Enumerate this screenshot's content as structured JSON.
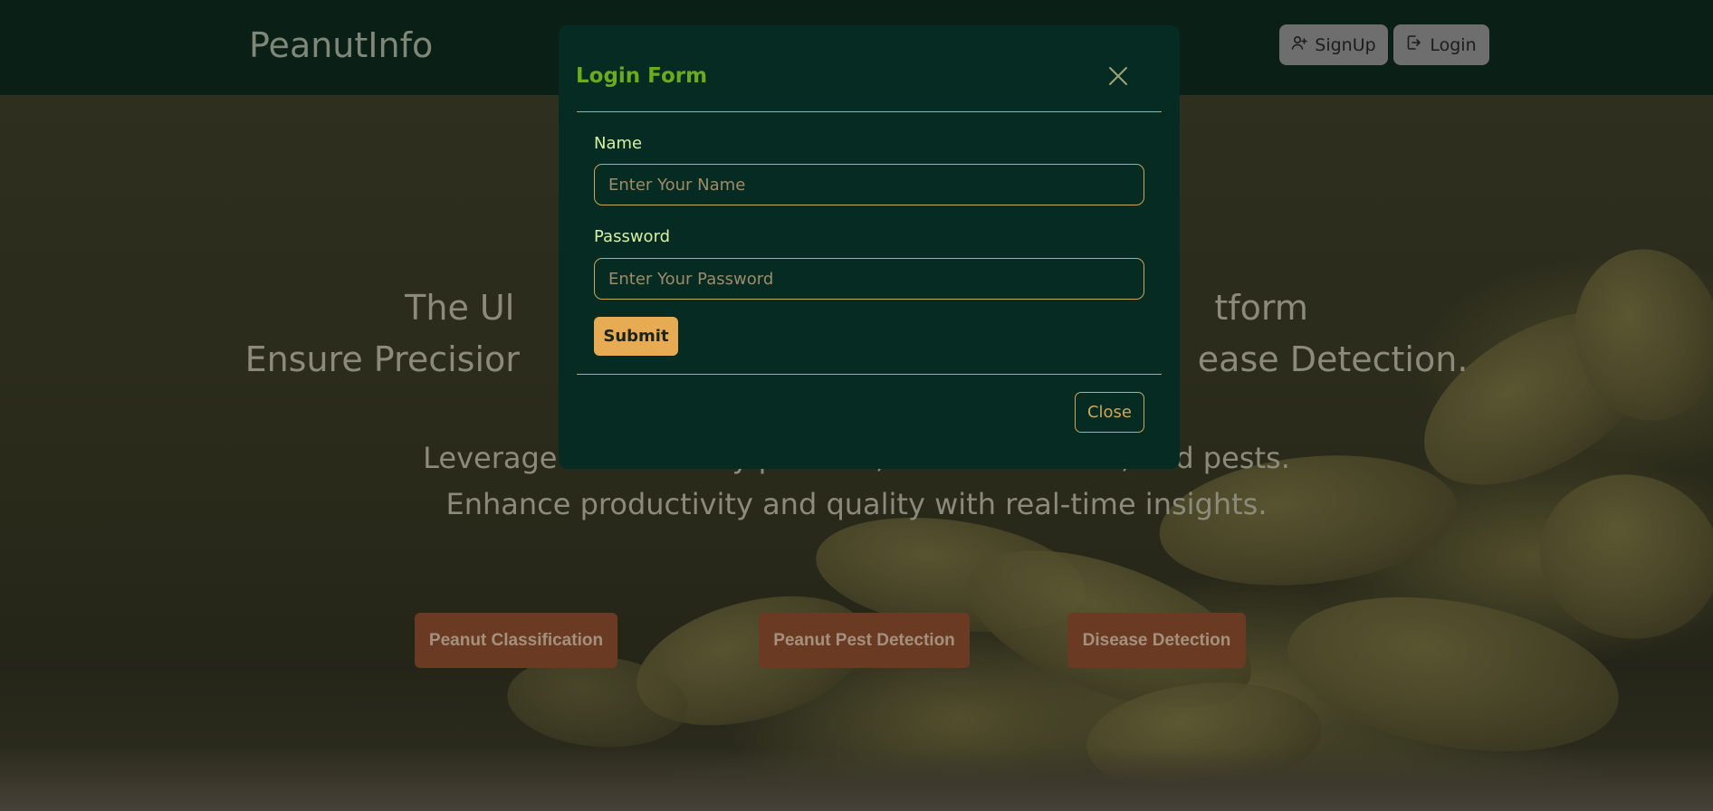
{
  "navbar": {
    "brand": "PeanutInfo",
    "signup_label": "SignUp",
    "login_label": "Login"
  },
  "hero": {
    "line1": "The Ul                                                                tform",
    "line2": "Ensure Precisior                                                              ease Detection.",
    "line3": "Leverage AI to classify peanuts, detect diseases, and pests.",
    "line4": "Enhance productivity and quality with real-time insights."
  },
  "features": [
    {
      "label": "Peanut Classification"
    },
    {
      "label": "Peanut Pest Detection"
    },
    {
      "label": "Disease Detection"
    }
  ],
  "modal": {
    "title": "Login Form",
    "name_label": "Name",
    "name_placeholder": "Enter Your Name",
    "password_label": "Password",
    "password_placeholder": "Enter Your Password",
    "submit_label": "Submit",
    "close_label": "Close"
  },
  "colors": {
    "navbar_bg": "#0a2017",
    "modal_bg": "#062b22",
    "modal_title": "#6cab1e",
    "accent_border": "#c9a95b",
    "submit_bg": "#e7ac53",
    "feature_button_bg": "#6a3b22"
  },
  "icons": {
    "signup": "user-plus-icon",
    "login": "login-icon",
    "close": "close-icon"
  }
}
